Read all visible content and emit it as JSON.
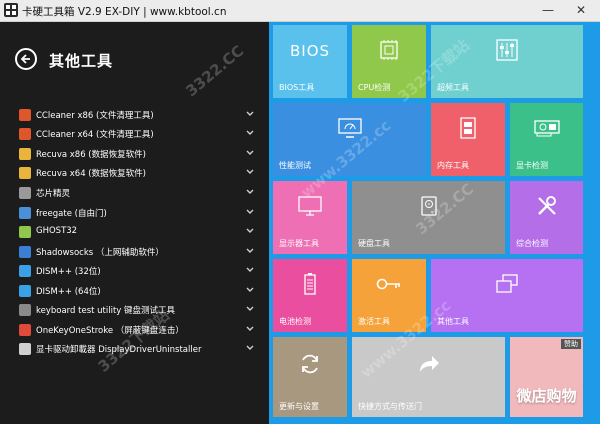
{
  "window": {
    "title": "卡硬工具箱 V2.9  EX-DIY   |   www.kbtool.cn",
    "minimize_glyph": "—",
    "close_glyph": "✕"
  },
  "panel": {
    "title": "其他工具"
  },
  "tools": [
    {
      "label": "CCleaner x86 (文件清理工具)",
      "icon": "ccleaner-icon",
      "color": "#e0562b"
    },
    {
      "label": "CCleaner x64 (文件清理工具)",
      "icon": "ccleaner-icon",
      "color": "#e0562b"
    },
    {
      "label": "Recuva x86 (数据恢复软件)",
      "icon": "recuva-icon",
      "color": "#e8b43a"
    },
    {
      "label": "Recuva x64 (数据恢复软件)",
      "icon": "recuva-icon",
      "color": "#e8b43a"
    },
    {
      "label": "芯片精灵",
      "icon": "chip-icon",
      "color": "#9a9a9a"
    },
    {
      "label": "freegate (自由门)",
      "icon": "freegate-icon",
      "color": "#4a90d9"
    },
    {
      "label": "GHOST32",
      "icon": "ghost-icon",
      "color": "#8fc84a"
    },
    {
      "label": "Shadowsocks （上网辅助软件）",
      "icon": "shadowsocks-icon",
      "color": "#3a7fd5"
    },
    {
      "label": "DISM++ (32位)",
      "icon": "dism-icon",
      "color": "#3aa0e8"
    },
    {
      "label": "DISM++ (64位)",
      "icon": "dism-icon",
      "color": "#3aa0e8"
    },
    {
      "label": "keyboard test utility 键盘测试工具",
      "icon": "keyboard-icon",
      "color": "#8a8a8a"
    },
    {
      "label": "OneKeyOneStroke （屏蔽键盘连击）",
      "icon": "onekey-icon",
      "color": "#e04a3a"
    },
    {
      "label": "显卡驱动卸載器 DisplayDriverUninstaller",
      "icon": "ddu-icon",
      "color": "#d0d0d0"
    }
  ],
  "tiles": {
    "bios": {
      "label": "BIOS工具",
      "icon_text": "BIOS",
      "color": "#5ac1ec"
    },
    "cpu": {
      "label": "CPU检测",
      "icon": "cpu-icon",
      "color": "#8fc84a"
    },
    "overclock": {
      "label": "超频工具",
      "icon": "sliders-icon",
      "color": "#6fd0cf"
    },
    "perf": {
      "label": "性能测试",
      "icon": "monitor-gauge-icon",
      "color": "#3a8fe0"
    },
    "memory": {
      "label": "内存工具",
      "icon": "memory-icon",
      "color": "#f0606a"
    },
    "gpu": {
      "label": "显卡检测",
      "icon": "gpu-icon",
      "color": "#3cc08a"
    },
    "display": {
      "label": "显示器工具",
      "icon": "display-icon",
      "color": "#ee6fb3"
    },
    "disk": {
      "label": "硬盘工具",
      "icon": "hdd-icon",
      "color": "#8f8f8f"
    },
    "general": {
      "label": "综合检测",
      "icon": "tools-icon",
      "color": "#b36ee8"
    },
    "battery": {
      "label": "电池检测",
      "icon": "battery-icon",
      "color": "#e94f9e"
    },
    "activate": {
      "label": "激活工具",
      "icon": "key-icon",
      "color": "#f5a23a"
    },
    "other": {
      "label": "其他工具",
      "icon": "windows-icon",
      "color": "#b671f2"
    },
    "update": {
      "label": "更新与设置",
      "icon": "refresh-icon",
      "color": "#a8987f"
    },
    "shortcut": {
      "label": "快捷方式与传送门",
      "icon": "share-icon",
      "color": "#c9c9c9"
    },
    "ad": {
      "text": "微店购物",
      "badge": "赞助",
      "color": "#f2b9bc"
    }
  },
  "watermark": [
    "3322.CC",
    "3322下载站",
    "www.3322.cc"
  ]
}
